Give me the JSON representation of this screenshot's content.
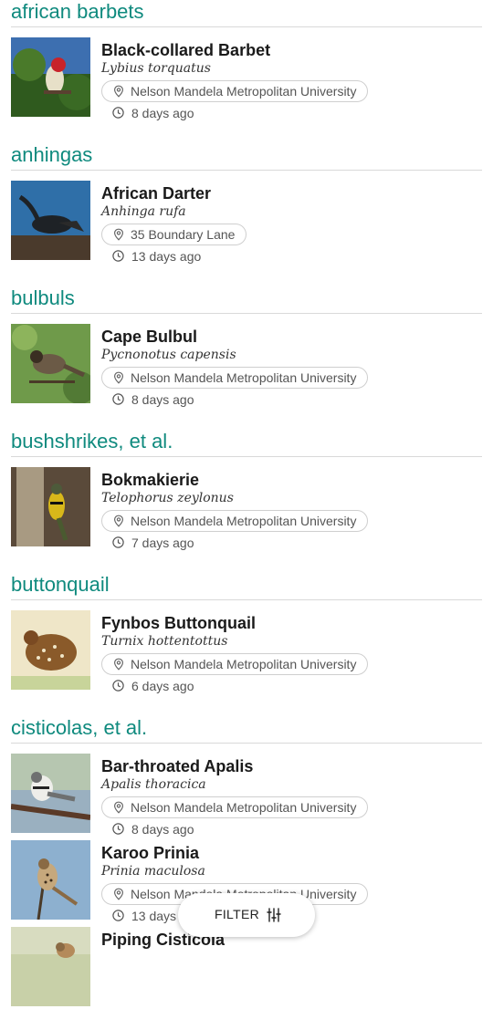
{
  "groups": [
    {
      "title": "african barbets",
      "entries": [
        {
          "common": "Black-collared Barbet",
          "scientific": "Lybius torquatus",
          "location": "Nelson Mandela Metropolitan University",
          "time": "8 days ago",
          "photo": "barbet"
        }
      ]
    },
    {
      "title": "anhingas",
      "entries": [
        {
          "common": "African Darter",
          "scientific": "Anhinga rufa",
          "location": "35 Boundary Lane",
          "time": "13 days ago",
          "photo": "darter"
        }
      ]
    },
    {
      "title": "bulbuls",
      "entries": [
        {
          "common": "Cape Bulbul",
          "scientific": "Pycnonotus capensis",
          "location": "Nelson Mandela Metropolitan University",
          "time": "8 days ago",
          "photo": "bulbul"
        }
      ]
    },
    {
      "title": "bushshrikes, et al.",
      "entries": [
        {
          "common": "Bokmakierie",
          "scientific": "Telophorus zeylonus",
          "location": "Nelson Mandela Metropolitan University",
          "time": "7 days ago",
          "photo": "bokmakierie"
        }
      ]
    },
    {
      "title": "buttonquail",
      "entries": [
        {
          "common": "Fynbos Buttonquail",
          "scientific": "Turnix hottentottus",
          "location": "Nelson Mandela Metropolitan University",
          "time": "6 days ago",
          "photo": "buttonquail"
        }
      ]
    },
    {
      "title": "cisticolas, et al.",
      "entries": [
        {
          "common": "Bar-throated Apalis",
          "scientific": "Apalis thoracica",
          "location": "Nelson Mandela Metropolitan University",
          "time": "8 days ago",
          "photo": "apalis"
        },
        {
          "common": "Karoo Prinia",
          "scientific": "Prinia maculosa",
          "location": "Nelson Mandela Metropolitan University",
          "time": "13 days ago",
          "photo": "prinia"
        },
        {
          "common": "Piping Cisticola",
          "scientific": "",
          "location": "",
          "time": "",
          "photo": "cisticola"
        }
      ]
    }
  ],
  "filter_button": {
    "label": "FILTER",
    "icon": "sliders-icon"
  },
  "icons": {
    "location": "location-pin-icon",
    "time": "clock-icon"
  },
  "colors": {
    "group_title": "#0f8a7e",
    "divider": "#d9d9d9"
  }
}
